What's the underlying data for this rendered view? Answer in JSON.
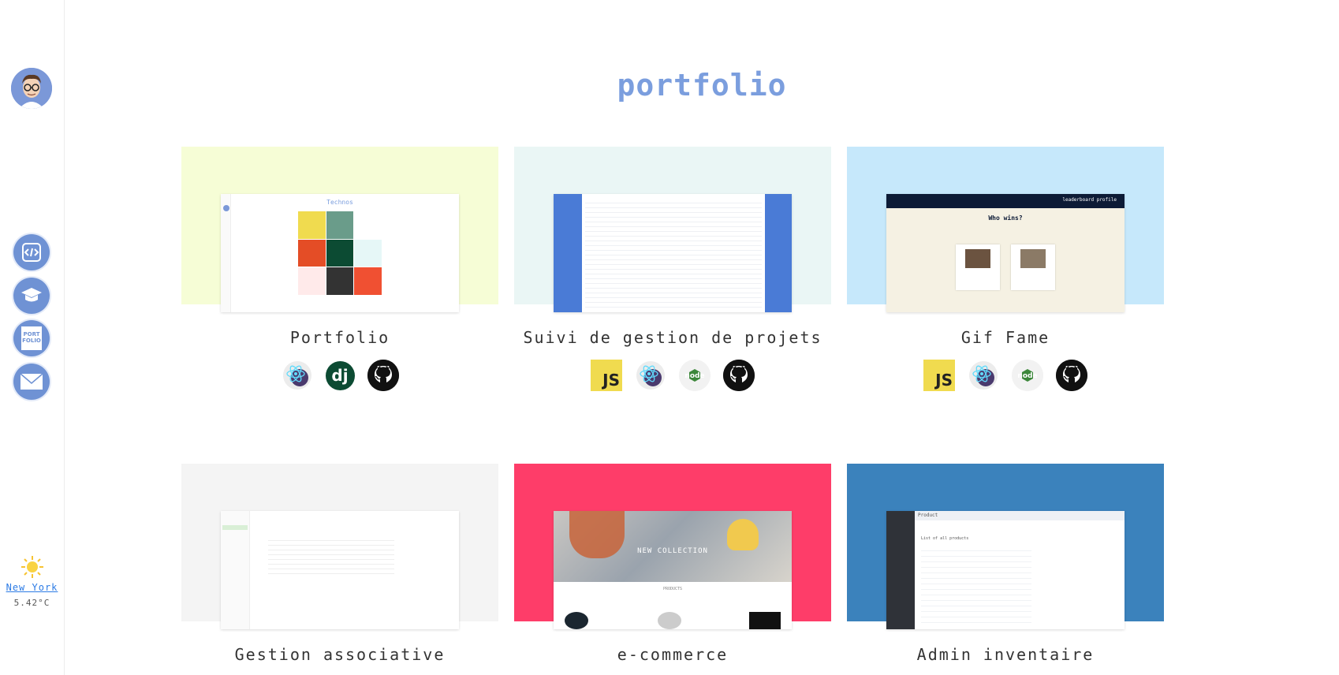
{
  "page": {
    "title": "portfolio"
  },
  "sidebar": {
    "nav": [
      {
        "icon": "code-icon"
      },
      {
        "icon": "graduation-cap-icon"
      },
      {
        "icon": "portfolio-icon",
        "label": "PORT\nFOLIO"
      },
      {
        "icon": "envelope-icon"
      }
    ],
    "weather": {
      "icon": "sun-icon",
      "city": "New York",
      "temp": "5.42°C"
    }
  },
  "projects": [
    {
      "name": "Portfolio",
      "bg": "#f6fdd6",
      "techs": [
        "react-icon",
        "django-icon",
        "github-icon"
      ],
      "shot_title": "Technos"
    },
    {
      "name": "Suivi de gestion de projets",
      "bg": "#eaf6f5",
      "techs": [
        "javascript-icon",
        "react-icon",
        "nodejs-icon",
        "github-icon"
      ]
    },
    {
      "name": "Gif Fame",
      "bg": "#c6e8fb",
      "techs": [
        "javascript-icon",
        "react-icon",
        "nodejs-icon",
        "github-icon"
      ],
      "shot_title": "Who wins?",
      "shot_header": "leaderboard  profile"
    },
    {
      "name": "Gestion associative",
      "bg": "#f4f4f4",
      "techs": []
    },
    {
      "name": "e-commerce",
      "bg": "#fe3d69",
      "techs": [],
      "shot_title": "NEW COLLECTION",
      "shot_sub": "PRODUCTS"
    },
    {
      "name": "Admin inventaire",
      "bg": "#3b82bc",
      "techs": [],
      "shot_title": "Product",
      "shot_sub": "List of all products"
    }
  ]
}
